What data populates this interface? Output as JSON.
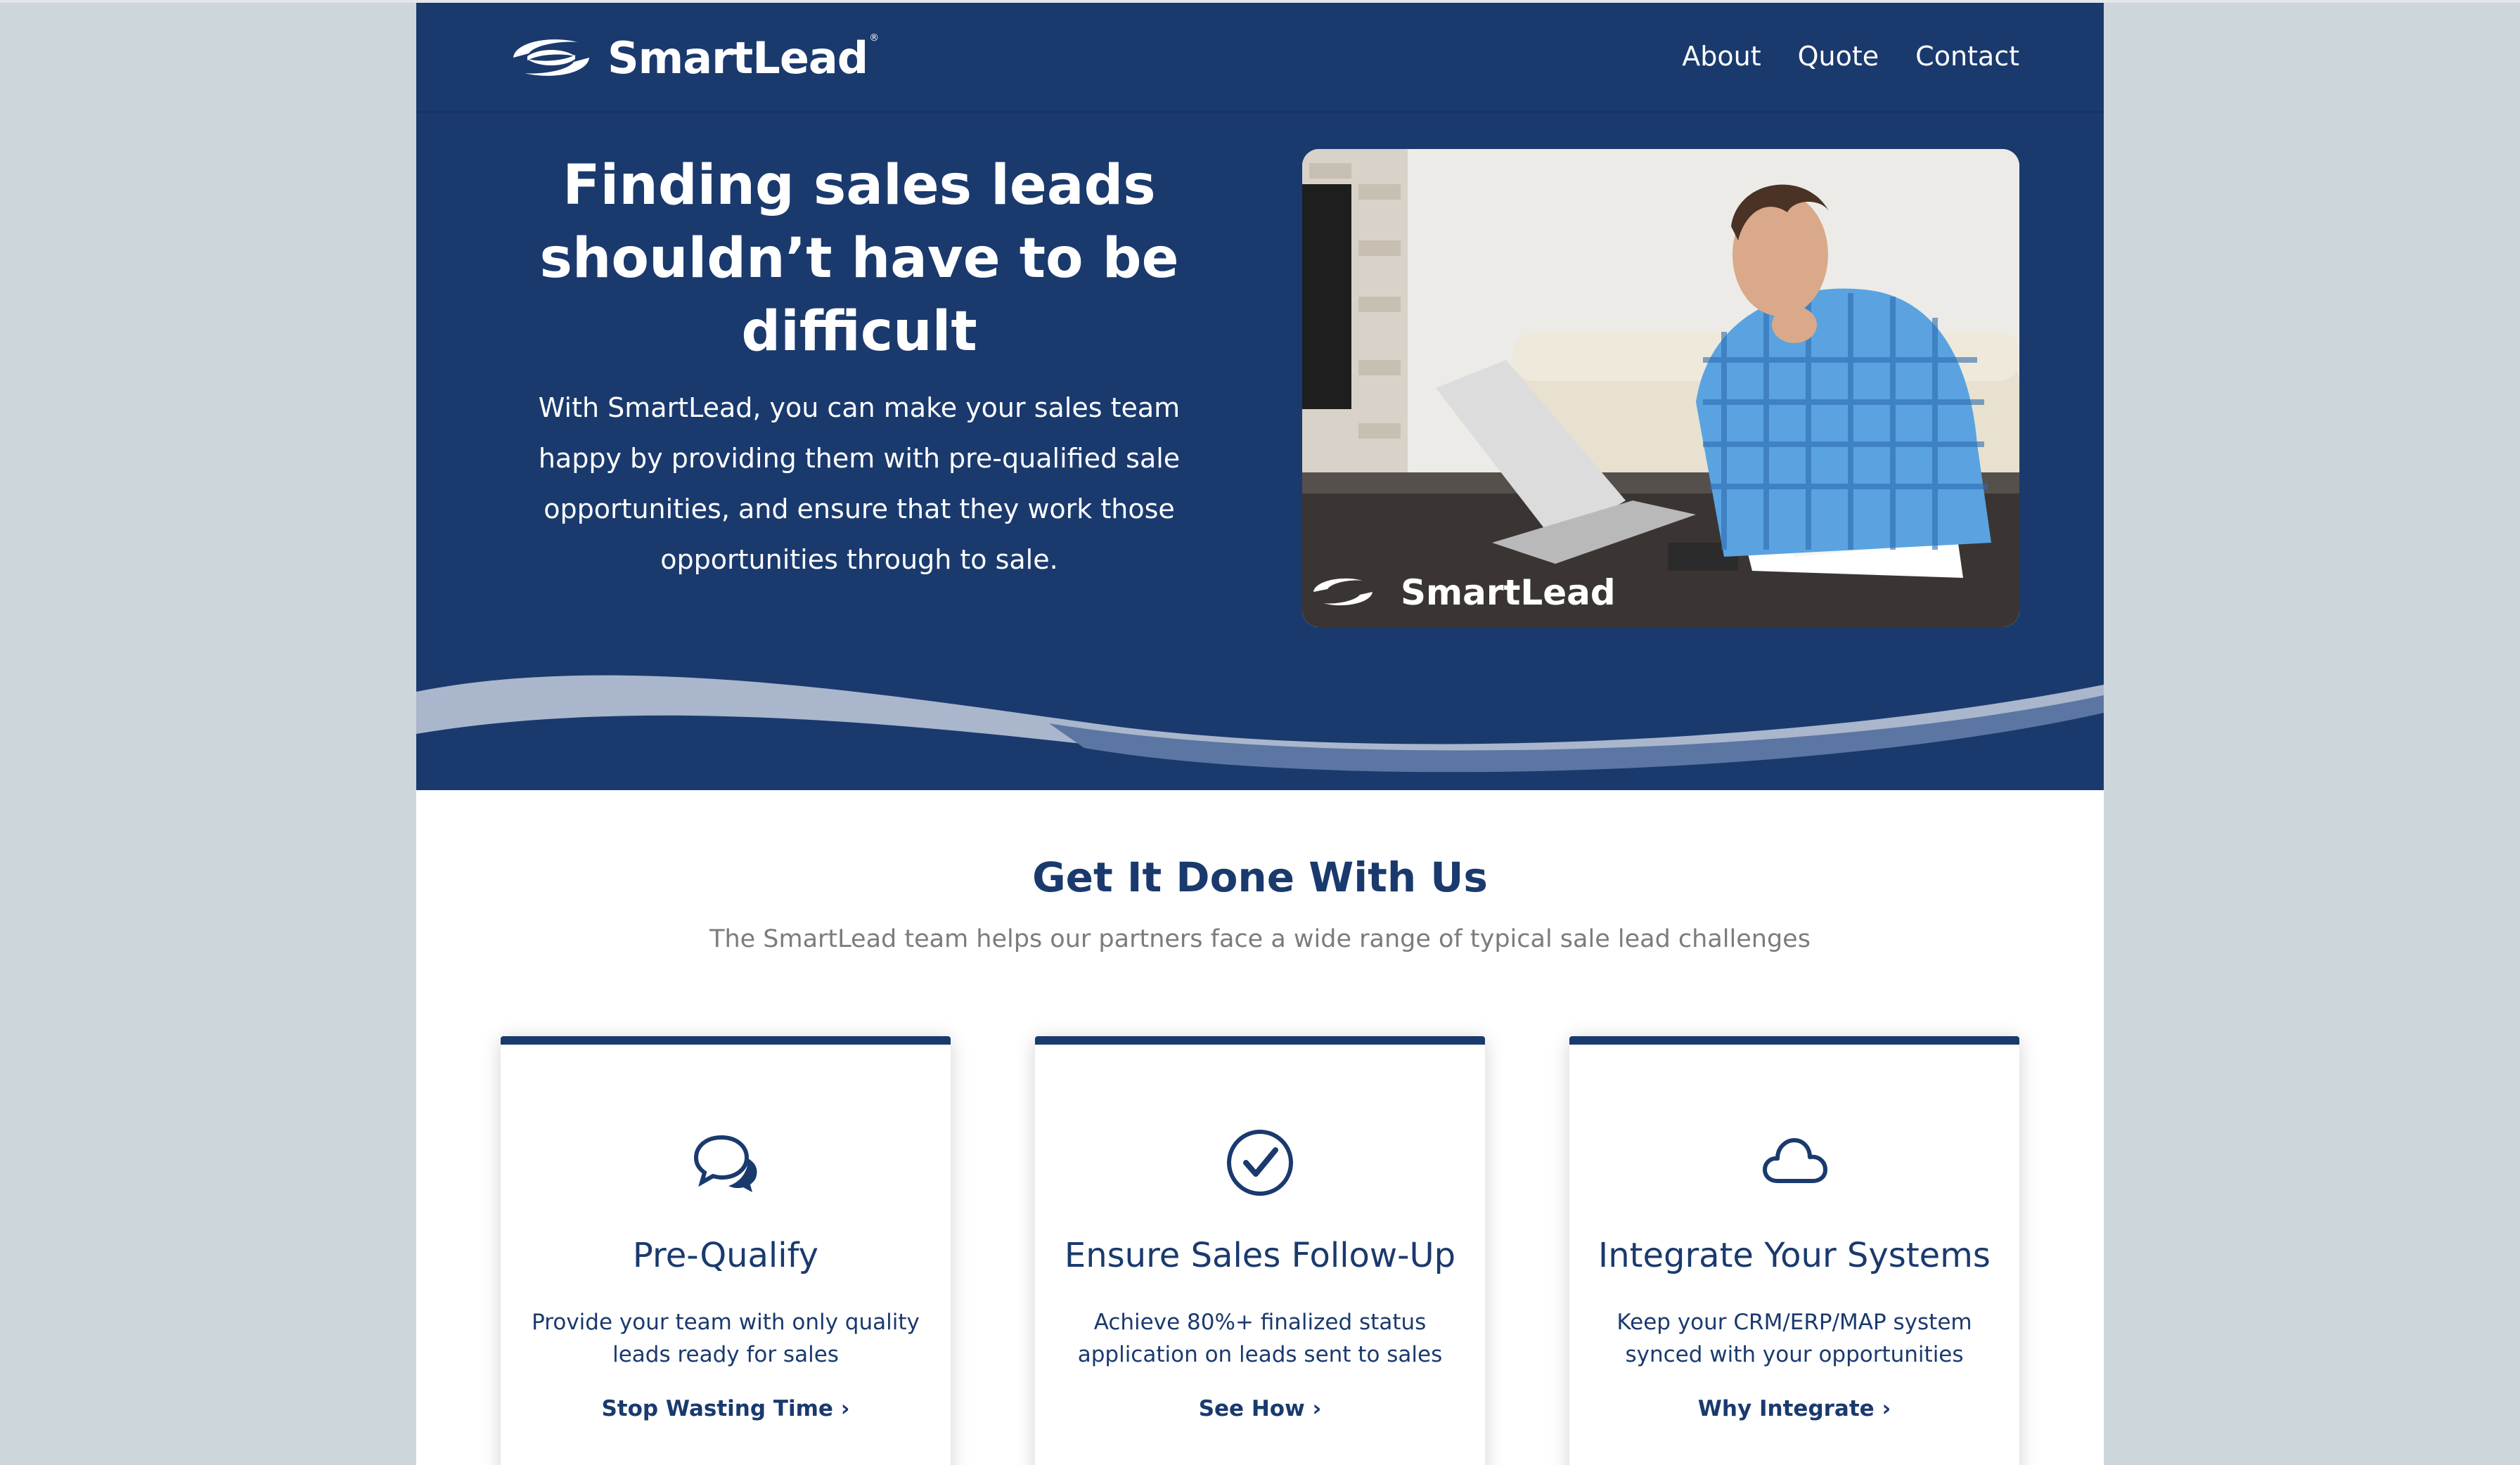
{
  "brand": {
    "name": "SmartLead",
    "registered": "®",
    "colors": {
      "primary": "#1a3a6e",
      "wave_light": "#a9b6cc",
      "wave_mid": "#5c76a3",
      "background": "#ccd6db"
    }
  },
  "nav": {
    "items": [
      {
        "label": "About"
      },
      {
        "label": "Quote"
      },
      {
        "label": "Contact"
      }
    ]
  },
  "hero": {
    "title": "Finding sales leads shouldn’t have to be difficult",
    "text": "With SmartLead, you can make your sales team happy by providing them with pre-qualified sale opportunities, and ensure that they work those opportunities through to sale.",
    "image": {
      "icon": "photo-man-with-laptop",
      "watermark": "SmartLead"
    }
  },
  "section": {
    "title": "Get It Done With Us",
    "subtitle": "The SmartLead team helps our partners face a wide range of typical sale lead challenges"
  },
  "cards": [
    {
      "icon": "chat-bubbles-icon",
      "title": "Pre-Qualify",
      "text": "Provide your team with only quality leads ready for sales",
      "link": "Stop Wasting Time ›"
    },
    {
      "icon": "check-circle-icon",
      "title": "Ensure Sales Follow-Up",
      "text": "Achieve 80%+ finalized status application on leads sent to sales",
      "link": "See How ›"
    },
    {
      "icon": "cloud-icon",
      "title": "Integrate Your Systems",
      "text": "Keep your CRM/ERP/MAP system synced with your opportunities",
      "link": "Why Integrate ›"
    }
  ]
}
